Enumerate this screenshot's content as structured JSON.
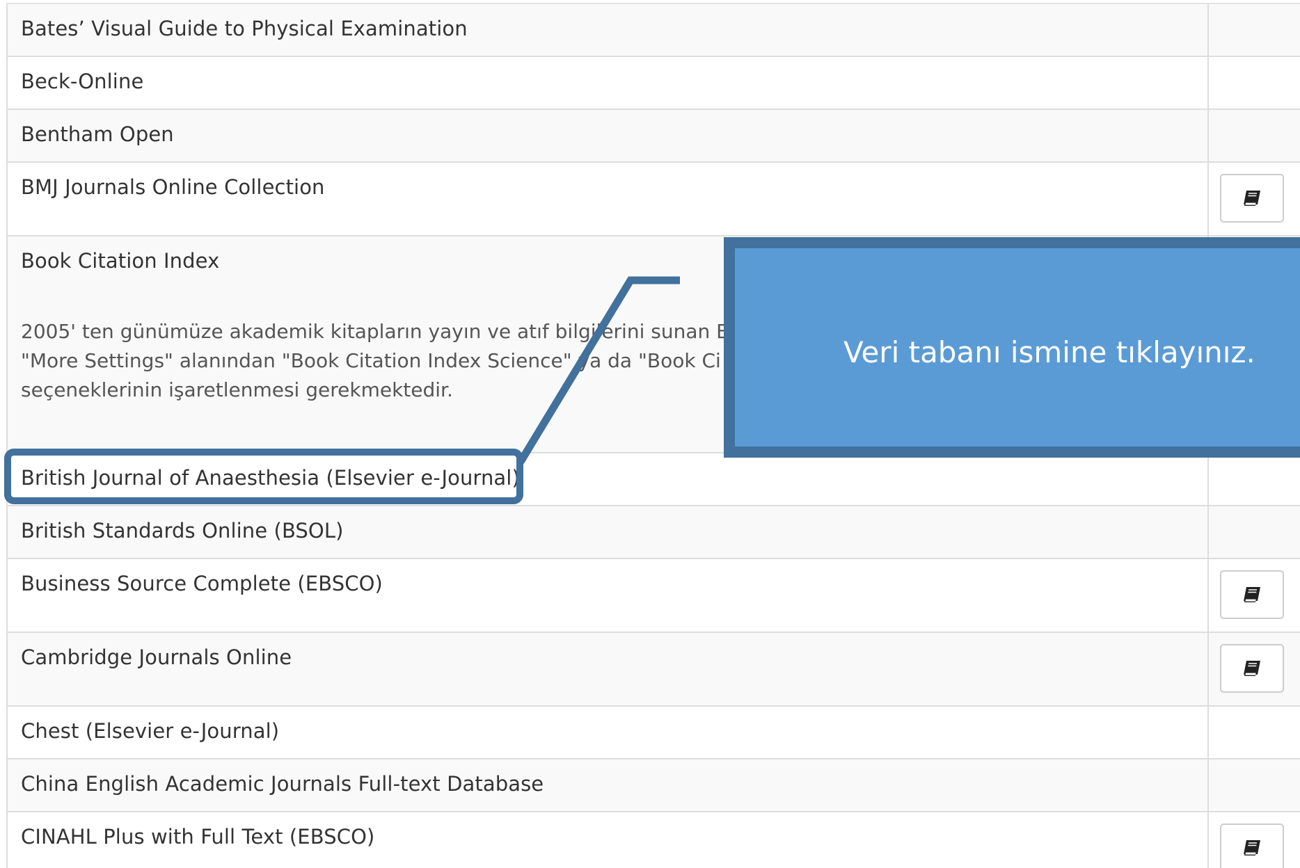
{
  "databases": [
    {
      "name": "Bates’ Visual Guide to Physical Examination",
      "has_guide": false
    },
    {
      "name": "Beck-Online",
      "has_guide": false
    },
    {
      "name": "Bentham Open",
      "has_guide": false
    },
    {
      "name": "BMJ Journals Online Collection",
      "has_guide": true
    },
    {
      "name": "Book Citation Index",
      "has_guide": false,
      "description_lines": [
        "2005' ten günümüze akademik kitapların yayın ve atıf bilgilerini sunan E",
        "\"More Settings\" alanından \"Book Citation Index Science\" ya da \"Book Ci",
        "seçeneklerinin işaretlenmesi gerekmektedir."
      ]
    },
    {
      "name": "British Journal of Anaesthesia (Elsevier e-Journal)",
      "has_guide": false
    },
    {
      "name": "British Standards Online (BSOL)",
      "has_guide": false
    },
    {
      "name": "Business Source Complete (EBSCO)",
      "has_guide": true
    },
    {
      "name": "Cambridge Journals Online",
      "has_guide": true
    },
    {
      "name": "Chest (Elsevier e-Journal)",
      "has_guide": false
    },
    {
      "name": "China English Academic Journals Full-text Database",
      "has_guide": false
    },
    {
      "name": "CINAHL Plus with Full Text (EBSCO)",
      "has_guide": true
    }
  ],
  "guide_icon": "book-icon",
  "callout": {
    "text": "Veri tabanı ismine tıklayınız.",
    "fill_color": "#5b9bd5",
    "border_color": "#41719c"
  },
  "colors": {
    "row_alt": "#f9f9f9",
    "row_plain": "#ffffff",
    "border": "#dddddd",
    "text": "#333333"
  }
}
